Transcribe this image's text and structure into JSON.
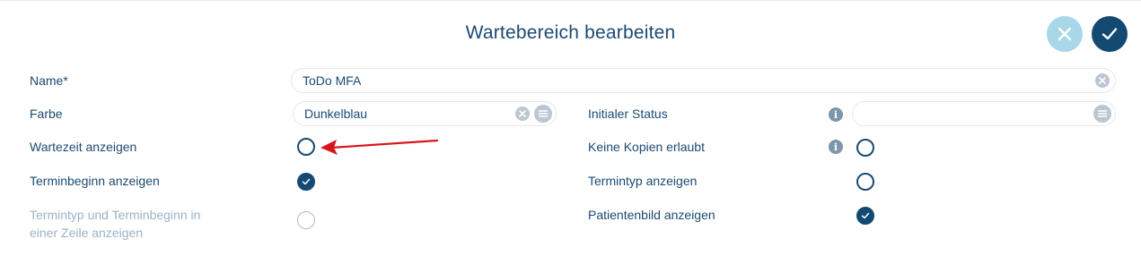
{
  "dialog": {
    "title": "Wartebereich bearbeiten"
  },
  "header": {
    "cancel_icon": "close-icon",
    "confirm_icon": "checkmark-icon"
  },
  "left": {
    "name_label": "Name*",
    "name_value": "ToDo MFA",
    "farbe_label": "Farbe",
    "farbe_value": "Dunkelblau",
    "wartezeit_label": "Wartezeit anzeigen",
    "wartezeit_checked": false,
    "terminbeginn_label": "Terminbeginn anzeigen",
    "terminbeginn_checked": true,
    "termintyp_zeile_label_1": "Termintyp und Terminbeginn in",
    "termintyp_zeile_label_2": "einer Zeile anzeigen",
    "termintyp_zeile_checked": false
  },
  "right": {
    "status_label": "Initialer Status",
    "status_value": "",
    "kopien_label": "Keine Kopien erlaubt",
    "kopien_checked": false,
    "termintyp_label": "Termintyp anzeigen",
    "termintyp_checked": false,
    "patientenbild_label": "Patientenbild anzeigen",
    "patientenbild_checked": true
  },
  "colors": {
    "primary": "#144a72",
    "accent_light": "#a7d7e8",
    "annotation_arrow": "#d9141b"
  }
}
